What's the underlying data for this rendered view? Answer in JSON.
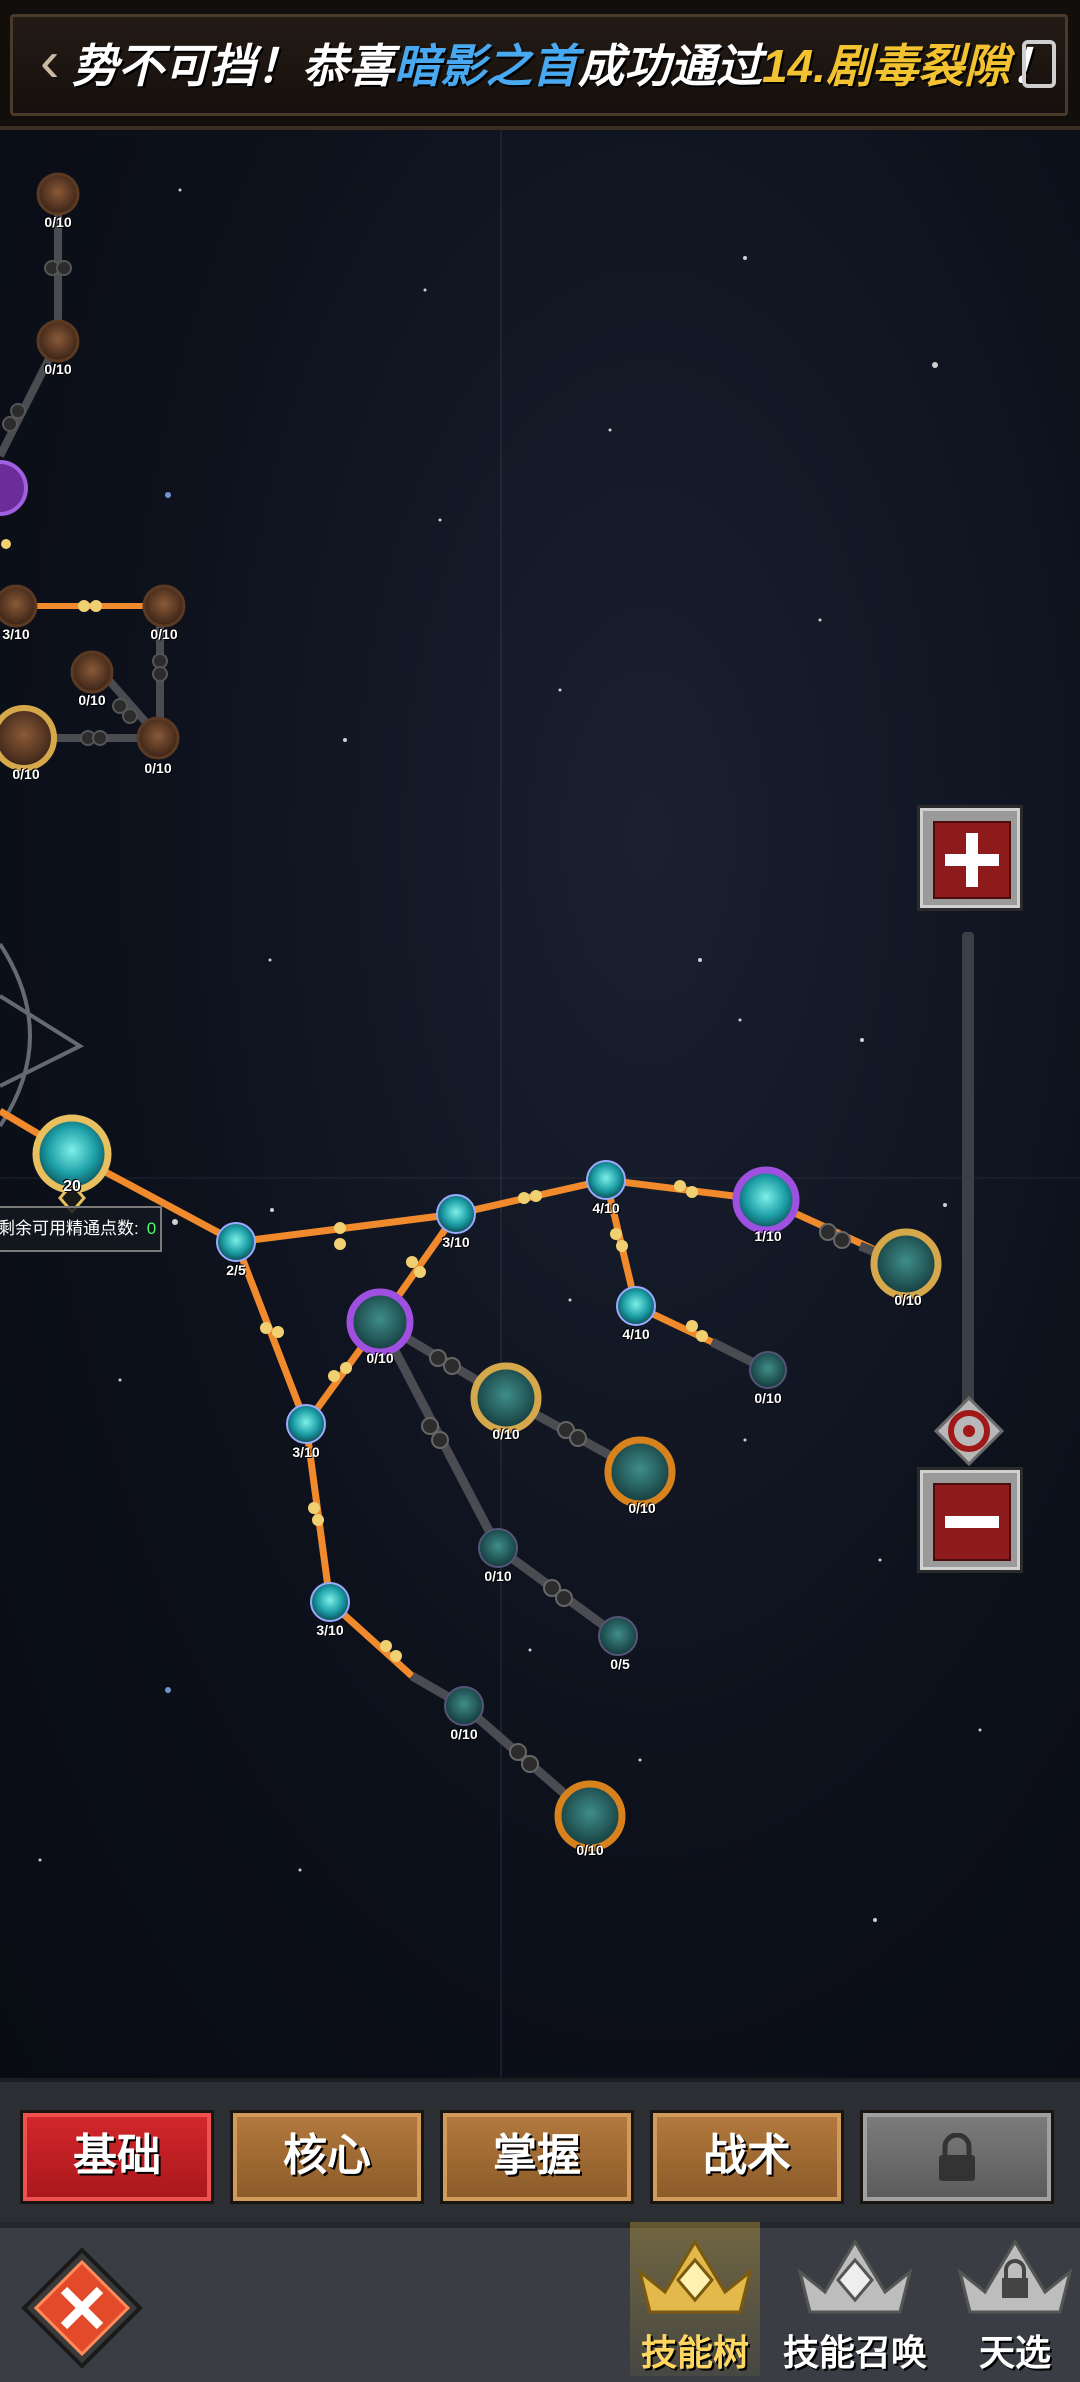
{
  "banner": {
    "back_icon": "chevron-left-icon",
    "part1": "势不可挡！恭喜",
    "player": "暗影之首",
    "part2": "成功通过",
    "stage": "14.剧毒裂隙",
    "part3": "！",
    "colors": {
      "player": "#48a8f0",
      "stage": "#f2c230"
    }
  },
  "skill_tree": {
    "root_level": "20",
    "points_label": "剩余可用精通点数:",
    "points_value": "0",
    "nodes": [
      {
        "id": "left-top-1",
        "label": "0/10"
      },
      {
        "id": "left-top-2",
        "label": "0/10"
      },
      {
        "id": "left-mid-1",
        "label": "3/10"
      },
      {
        "id": "left-mid-2",
        "label": "0/10"
      },
      {
        "id": "left-mid-3",
        "label": "0/10"
      },
      {
        "id": "left-mid-4",
        "label": "0/10"
      },
      {
        "id": "left-mid-5",
        "label": "0/10"
      },
      {
        "id": "n-2-5",
        "label": "2/5"
      },
      {
        "id": "n-3-10-a",
        "label": "3/10"
      },
      {
        "id": "n-4-10-top",
        "label": "4/10"
      },
      {
        "id": "n-1-10",
        "label": "1/10"
      },
      {
        "id": "n-gold-right",
        "label": "0/10"
      },
      {
        "id": "n-4-10-mid",
        "label": "4/10"
      },
      {
        "id": "n-0-10-small-right",
        "label": "0/10"
      },
      {
        "id": "n-purple-mid",
        "label": "0/10"
      },
      {
        "id": "n-gold-mid",
        "label": "0/10"
      },
      {
        "id": "n-orange-right",
        "label": "0/10"
      },
      {
        "id": "n-3-10-b",
        "label": "3/10"
      },
      {
        "id": "n-0-10-small-a",
        "label": "0/10"
      },
      {
        "id": "n-0-5",
        "label": "0/5"
      },
      {
        "id": "n-3-10-c",
        "label": "3/10"
      },
      {
        "id": "n-0-10-small-b",
        "label": "0/10"
      },
      {
        "id": "n-orange-bottom",
        "label": "0/10"
      }
    ]
  },
  "zoom": {
    "in_icon": "plus-icon",
    "out_icon": "minus-icon",
    "handle_icon": "target-icon"
  },
  "tabs": [
    {
      "label": "基础",
      "state": "active"
    },
    {
      "label": "核心",
      "state": "normal"
    },
    {
      "label": "掌握",
      "state": "normal"
    },
    {
      "label": "战术",
      "state": "normal"
    },
    {
      "label": "",
      "state": "locked",
      "icon": "lock-icon"
    }
  ],
  "nav": {
    "close_icon": "close-icon",
    "items": [
      {
        "label": "技能树",
        "icon": "skill-tree-icon",
        "active": true
      },
      {
        "label": "技能召唤",
        "icon": "skill-summon-icon",
        "active": false
      },
      {
        "label": "天选",
        "icon": "locked-crown-icon",
        "active": false
      }
    ]
  },
  "colors": {
    "orange_path": "#f08a2c",
    "gray_path": "#4a4c52",
    "teal": "#2ec4c4",
    "purple": "#8b3fd0",
    "gold": "#d6a84c",
    "red_tab": "#c41f22"
  }
}
